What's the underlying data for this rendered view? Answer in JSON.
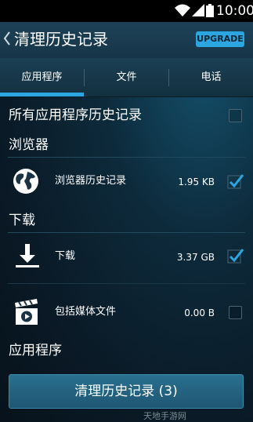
{
  "status_bar": {
    "time": "10:00",
    "icons": [
      "wifi-icon",
      "signal-icon",
      "battery-icon"
    ]
  },
  "app_bar": {
    "title": "清理历史记录",
    "upgrade_label": "UPGRADE"
  },
  "tabs": [
    {
      "label": "应用程序",
      "selected": true
    },
    {
      "label": "文件",
      "selected": false
    },
    {
      "label": "电话",
      "selected": false
    }
  ],
  "all_apps_row": {
    "label": "所有应用程序历史记录",
    "checked": false
  },
  "sections": {
    "browser": "浏览器",
    "downloads": "下载",
    "apps": "应用程序"
  },
  "items": [
    {
      "label": "浏览器历史记录",
      "size": "1.95 KB",
      "icon": "globe-icon",
      "checked": true
    },
    {
      "label": "下载",
      "size": "3.37 GB",
      "icon": "download-icon",
      "checked": true
    },
    {
      "label": "包括媒体文件",
      "size": "0.00 B",
      "icon": "media-clapper-icon",
      "checked": false
    }
  ],
  "bottom_button": {
    "label": "清理历史记录 (3)"
  },
  "watermark": "天地手游网",
  "colors": {
    "accent": "#2ba6e0",
    "appbar": "#1d4258",
    "background": "#0a1a26"
  }
}
